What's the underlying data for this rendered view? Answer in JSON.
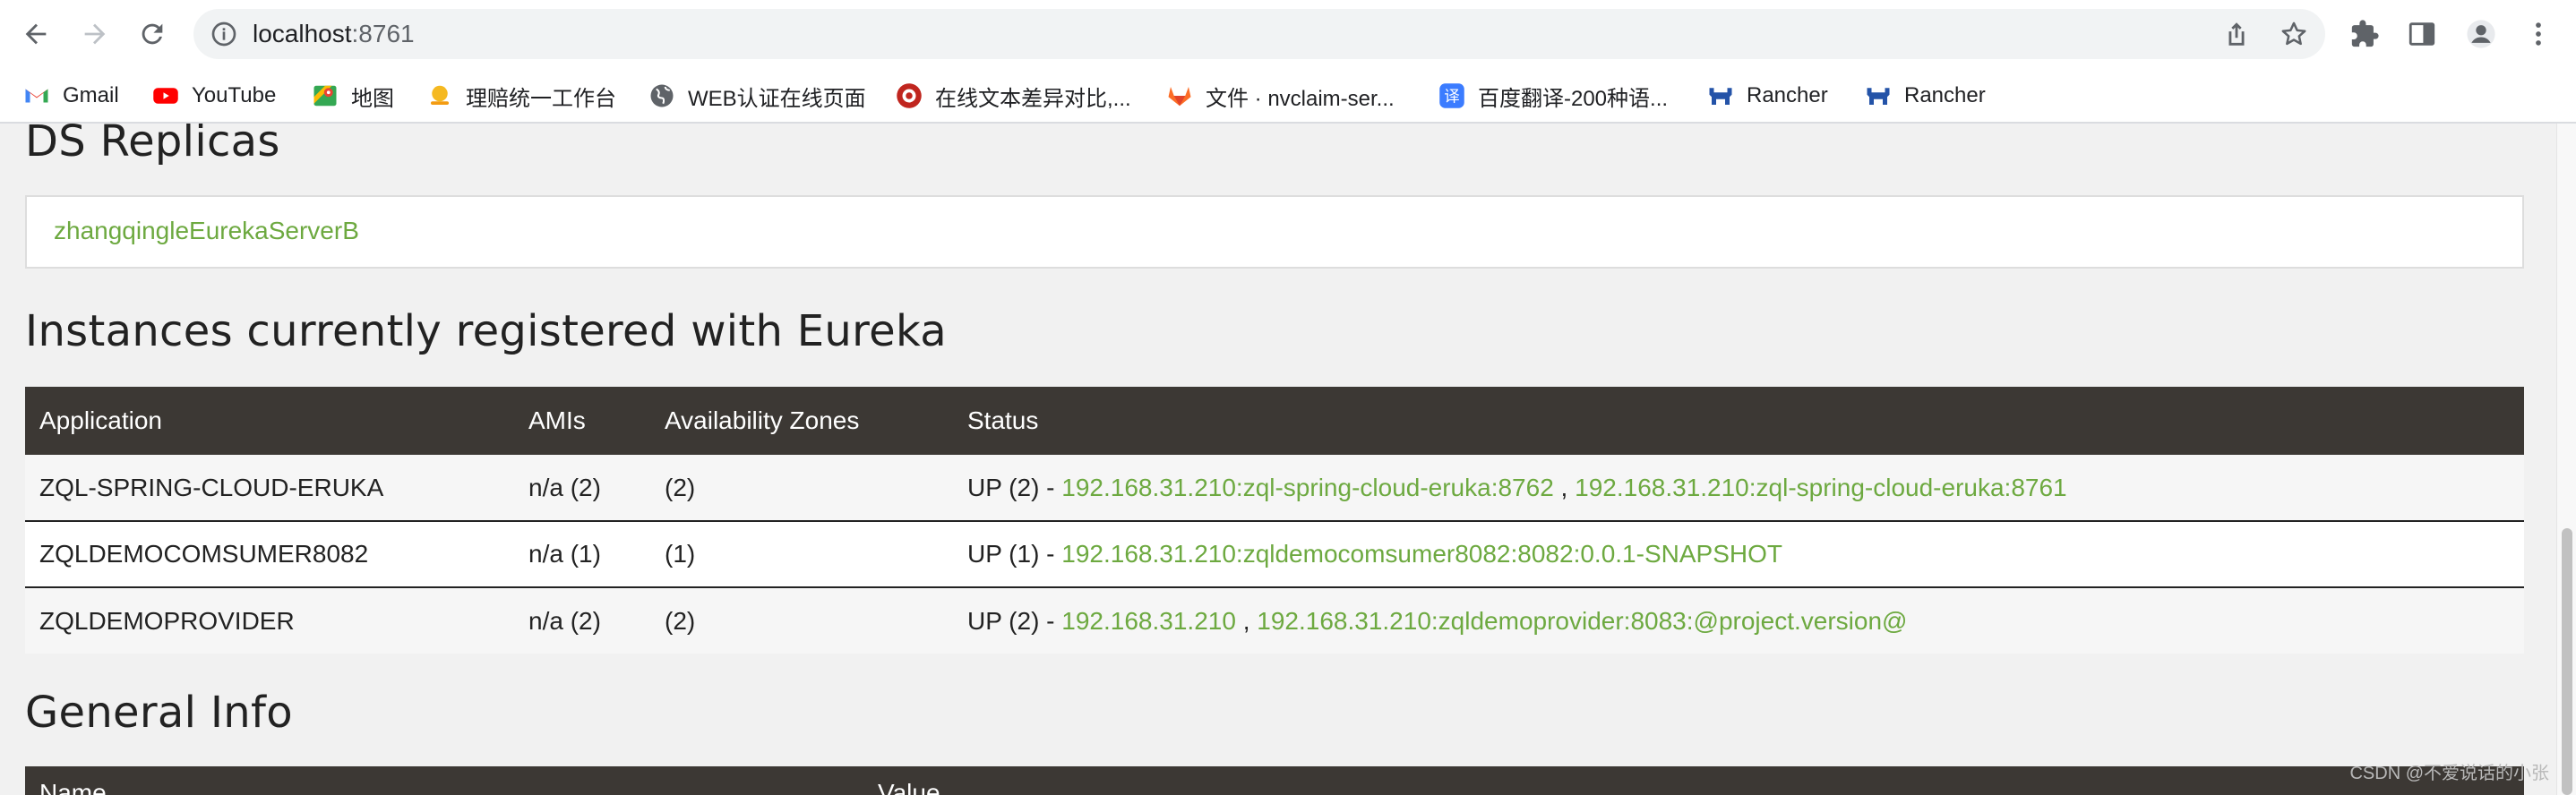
{
  "browser": {
    "url_host": "localhost",
    "url_port": ":8761"
  },
  "bookmarks": [
    {
      "label": "Gmail",
      "icon": "gmail-icon"
    },
    {
      "label": "YouTube",
      "icon": "youtube-icon"
    },
    {
      "label": "地图",
      "icon": "maps-icon"
    },
    {
      "label": "理赔统一工作台",
      "icon": "workbench-icon"
    },
    {
      "label": "WEB认证在线页面",
      "icon": "globe-icon"
    },
    {
      "label": "在线文本差异对比,...",
      "icon": "diff-icon"
    },
    {
      "label": "文件 · nvclaim-ser...",
      "icon": "gitlab-icon"
    },
    {
      "label": "百度翻译-200种语...",
      "icon": "translate-icon"
    },
    {
      "label": "Rancher",
      "icon": "rancher-icon"
    },
    {
      "label": "Rancher",
      "icon": "rancher-icon"
    }
  ],
  "ds_replicas": {
    "title": "DS Replicas",
    "link": "zhangqingleEurekaServerB"
  },
  "instances": {
    "title": "Instances currently registered with Eureka",
    "headers": [
      "Application",
      "AMIs",
      "Availability Zones",
      "Status"
    ],
    "rows": [
      {
        "app": "ZQL-SPRING-CLOUD-ERUKA",
        "amis": "n/a (2)",
        "zones": "(2)",
        "status_prefix": "UP (2) - ",
        "link1": "192.168.31.210:zql-spring-cloud-eruka:8762",
        "sep": " , ",
        "link2": "192.168.31.210:zql-spring-cloud-eruka:8761"
      },
      {
        "app": "ZQLDEMOCOMSUMER8082",
        "amis": "n/a (1)",
        "zones": "(1)",
        "status_prefix": "UP (1) - ",
        "link1": "192.168.31.210:zqldemocomsumer8082:8082:0.0.1-SNAPSHOT"
      },
      {
        "app": "ZQLDEMOPROVIDER",
        "amis": "n/a (2)",
        "zones": "(2)",
        "status_prefix": "UP (2) - ",
        "link1": "192.168.31.210",
        "sep": " , ",
        "link2": "192.168.31.210:zqldemoprovider:8083:@project.version@"
      }
    ]
  },
  "general_info": {
    "title": "General Info",
    "headers": [
      "Name",
      "Value"
    ]
  },
  "watermark": "CSDN @不爱说话的小张",
  "colors": {
    "link": "#6da940",
    "table_header": "#3c3834"
  }
}
